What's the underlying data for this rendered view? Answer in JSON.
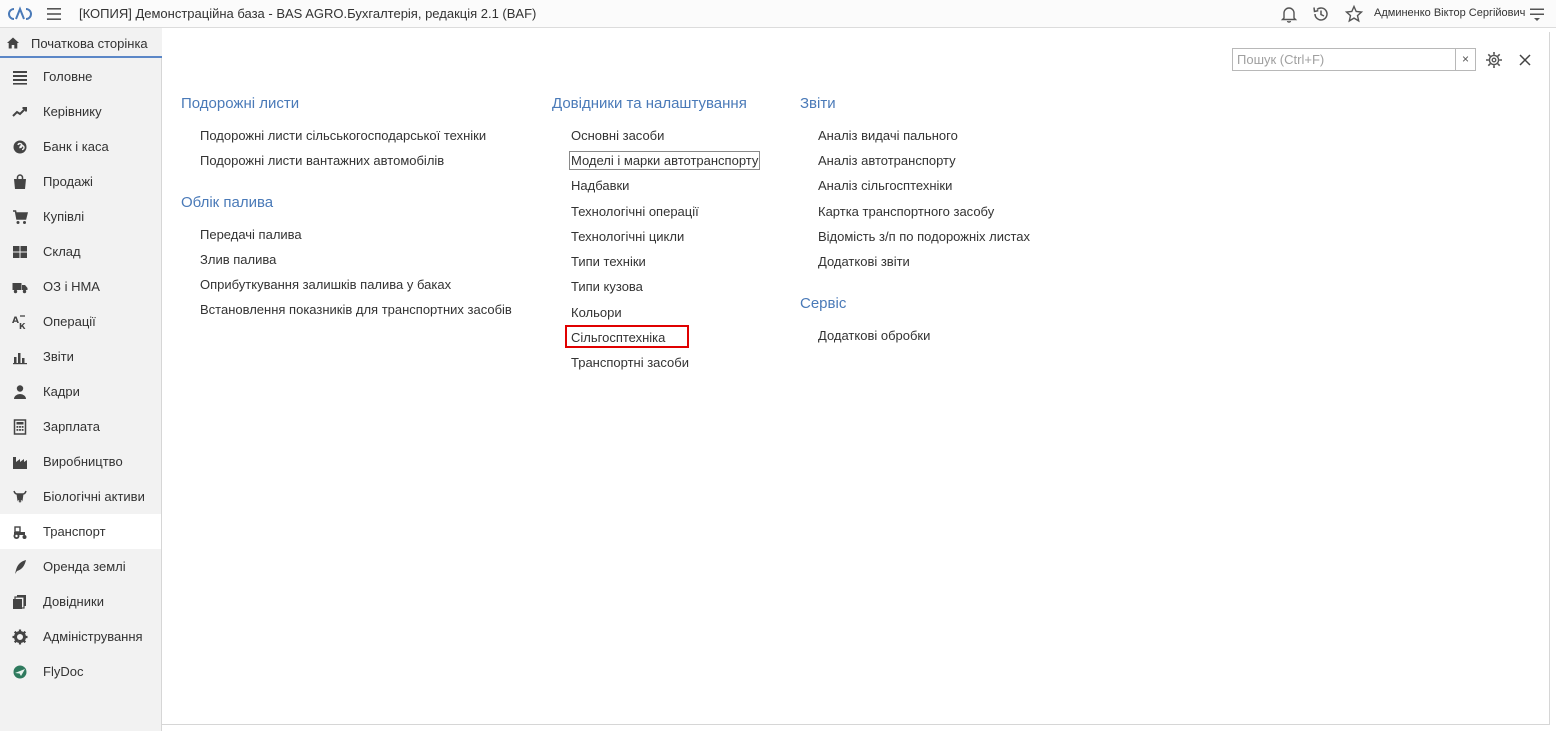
{
  "window": {
    "title": "[КОПИЯ] Демонстраційна база - BAS AGRO.Бухгалтерія, редакція 2.1  (BAF)",
    "user": "Админенко Віктор Сергійович"
  },
  "home_tab": {
    "label": "Початкова сторінка"
  },
  "sidebar": {
    "items": [
      {
        "label": "Головне",
        "icon": "list-icon"
      },
      {
        "label": "Керівнику",
        "icon": "trend-icon"
      },
      {
        "label": "Банк і каса",
        "icon": "coin-icon"
      },
      {
        "label": "Продажі",
        "icon": "bag-icon"
      },
      {
        "label": "Купівлі",
        "icon": "cart-icon"
      },
      {
        "label": "Склад",
        "icon": "grid-icon"
      },
      {
        "label": "ОЗ і НМА",
        "icon": "truck-icon"
      },
      {
        "label": "Операції",
        "icon": "operations-icon"
      },
      {
        "label": "Звіти",
        "icon": "bar-chart-icon"
      },
      {
        "label": "Кадри",
        "icon": "person-icon"
      },
      {
        "label": "Зарплата",
        "icon": "calculator-icon"
      },
      {
        "label": "Виробництво",
        "icon": "factory-icon"
      },
      {
        "label": "Біологічні активи",
        "icon": "cow-icon"
      },
      {
        "label": "Транспорт",
        "icon": "tractor-icon"
      },
      {
        "label": "Оренда землі",
        "icon": "feather-icon"
      },
      {
        "label": "Довідники",
        "icon": "books-icon"
      },
      {
        "label": "Адміністрування",
        "icon": "gear-icon"
      },
      {
        "label": "FlyDoc",
        "icon": "flydoc-icon"
      }
    ],
    "active_label": "Транспорт"
  },
  "search": {
    "placeholder": "Пошук (Ctrl+F)",
    "value": "",
    "clear": "×"
  },
  "sections": {
    "waybills": {
      "title": "Подорожні листи",
      "links": [
        "Подорожні листи сільськогосподарської техніки",
        "Подорожні листи вантажних автомобілів"
      ]
    },
    "fuel": {
      "title": "Облік палива",
      "links": [
        "Передачі палива",
        "Злив палива",
        "Оприбуткування залишків палива у баках",
        "Встановлення показників для транспортних засобів"
      ]
    },
    "catalogs": {
      "title": "Довідники та налаштування",
      "links": [
        "Основні засоби",
        "Моделі і марки автотранспорту",
        "Надбавки",
        "Технологічні операції",
        "Технологічні цикли",
        "Типи техніки",
        "Типи кузова",
        "Кольори",
        "Сільгосптехніка",
        "Транспортні засоби"
      ]
    },
    "reports": {
      "title": "Звіти",
      "links": [
        "Аналіз видачі пального",
        "Аналіз автотранспорту",
        "Аналіз сільгосптехніки",
        "Картка транспортного засобу",
        "Відомість з/п по подорожніх листах",
        "Додаткові звіти"
      ]
    },
    "service": {
      "title": "Сервіс",
      "links": [
        "Додаткові обробки"
      ]
    }
  },
  "colors": {
    "section_title": "#4a7ab8",
    "highlight_border": "#e00000",
    "sidebar_bg": "#f2f2f2",
    "home_tab_underline": "#5b87c7"
  }
}
